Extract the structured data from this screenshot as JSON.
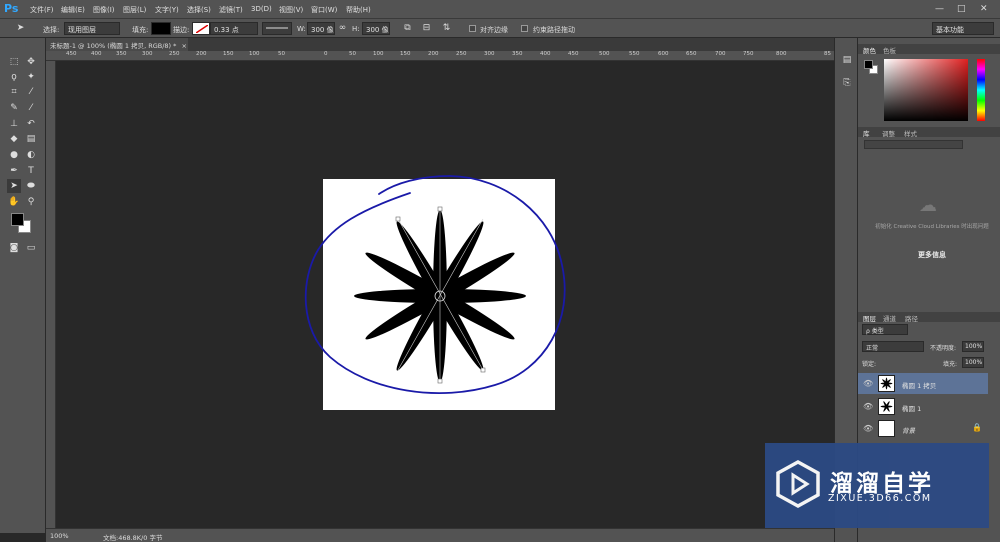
{
  "app": {
    "logo": "Ps"
  },
  "menu": [
    "文件(F)",
    "编辑(E)",
    "图像(I)",
    "图层(L)",
    "文字(Y)",
    "选择(S)",
    "滤镜(T)",
    "3D(D)",
    "视图(V)",
    "窗口(W)",
    "帮助(H)"
  ],
  "window_controls": [
    "—",
    "□",
    "✕"
  ],
  "options": {
    "select_label": "选择:",
    "select_value": "现用图层",
    "fill_label": "填充:",
    "stroke_label": "描边:",
    "stroke_width": "0.33 点",
    "w_label": "W:",
    "w_value": "300 像",
    "h_label": "H:",
    "h_value": "300 像",
    "align_edges": "对齐边缘",
    "constrain_path": "约束路径拖动",
    "workspace": "基本功能"
  },
  "document": {
    "tab_title": "未标题-1 @ 100% (椭圆 1 拷贝, RGB/8) *",
    "tab_close": "×",
    "ruler_ticks": [
      "450",
      "400",
      "350",
      "300",
      "250",
      "200",
      "150",
      "100",
      "50",
      "0",
      "50",
      "100",
      "150",
      "200",
      "250",
      "300",
      "350",
      "400",
      "450",
      "500",
      "550",
      "600",
      "650",
      "700",
      "750",
      "800",
      "85"
    ]
  },
  "status": {
    "zoom": "100%",
    "doc_info": "文档:468.8K/0 字节"
  },
  "panels": {
    "color_tabs": [
      "颜色",
      "色板"
    ],
    "library_tabs": [
      "库",
      "调整",
      "样式"
    ],
    "library_message": "初始化 Creative Cloud Libraries 时出现问题",
    "library_more": "更多信息",
    "layers_tabs": [
      "图层",
      "通道",
      "路径"
    ],
    "kind_filter": "ρ 类型",
    "blend_mode": "正常",
    "opacity_label": "不透明度:",
    "opacity_value": "100%",
    "lock_label": "锁定:",
    "fill_label": "填充:",
    "fill_value": "100%",
    "layers": [
      {
        "name": "椭圆 1 拷贝",
        "selected": true
      },
      {
        "name": "椭圆 1",
        "selected": false
      },
      {
        "name": "背景",
        "selected": false
      }
    ]
  },
  "colors": {
    "accent": "#31a8ff",
    "selection": "#5d7397",
    "annotation_stroke": "#1a1aa8",
    "watermark_bg": "#2c4a84"
  },
  "watermark": {
    "title": "溜溜自学",
    "subtitle": "ZIXUE.3D66.COM"
  }
}
